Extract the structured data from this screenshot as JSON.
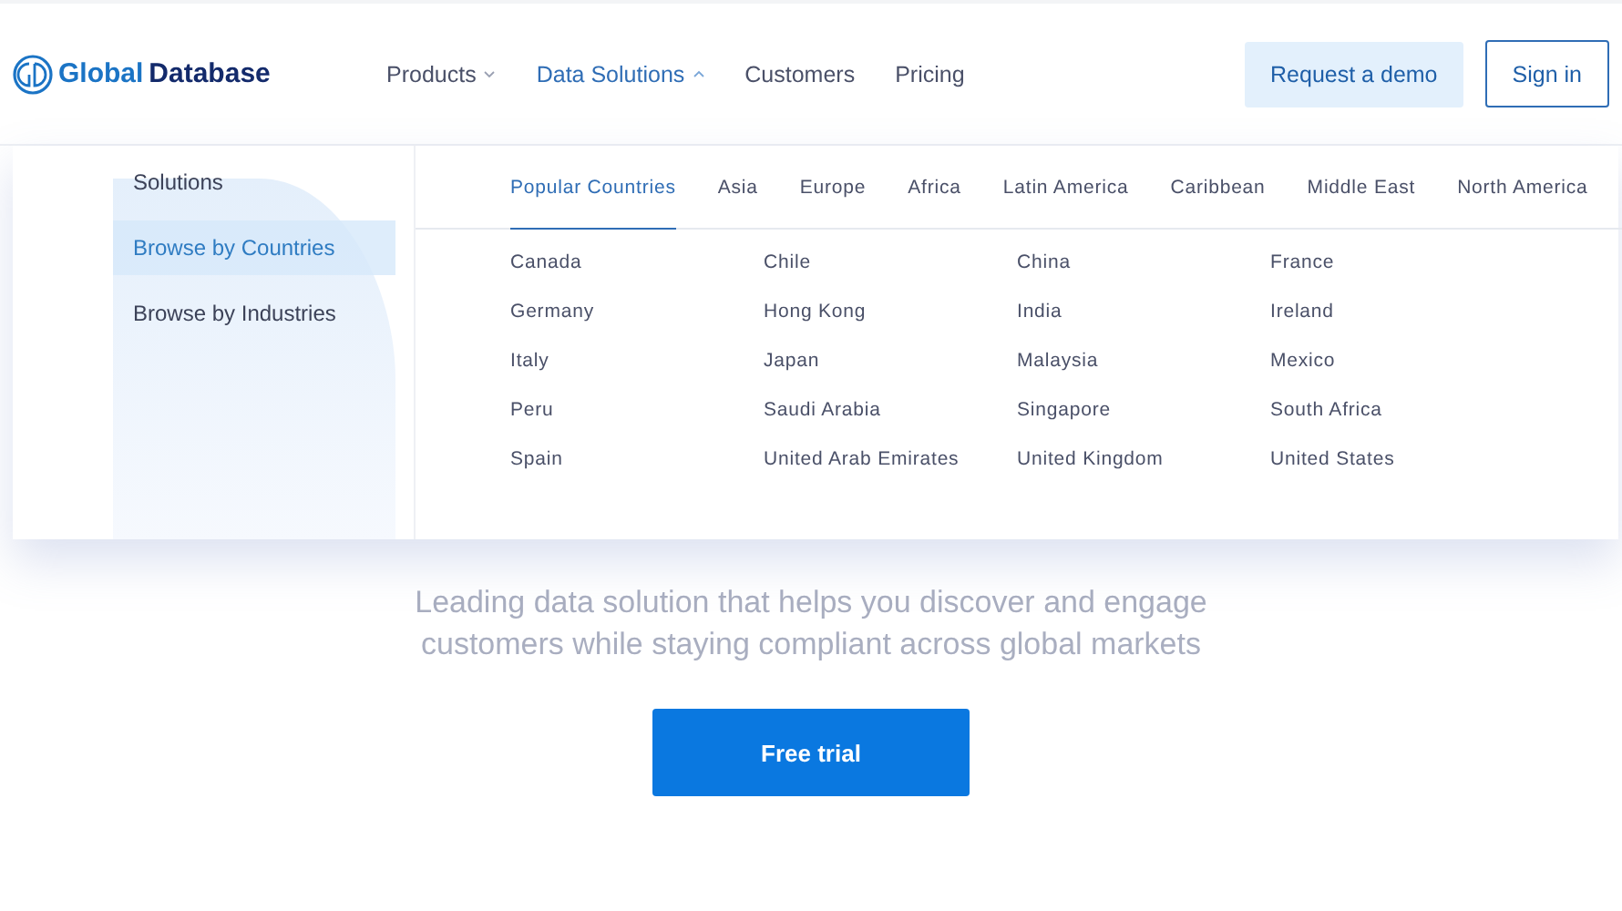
{
  "logo": {
    "word_1": "Global",
    "word_2": "Database"
  },
  "nav": [
    {
      "label": "Products",
      "kind": "dropdown",
      "expanded": false
    },
    {
      "label": "Data Solutions",
      "kind": "dropdown",
      "expanded": true
    },
    {
      "label": "Customers",
      "kind": "link",
      "expanded": false
    },
    {
      "label": "Pricing",
      "kind": "link",
      "expanded": false
    }
  ],
  "header_buttons": [
    {
      "label": "Request a demo",
      "kind": "soft"
    },
    {
      "label": "Sign in",
      "kind": "outline"
    }
  ],
  "dropdown": {
    "sidebar": {
      "heading": "Solutions",
      "items": [
        {
          "label": "Browse by Countries",
          "selected": true
        },
        {
          "label": "Browse by Industries",
          "selected": false
        }
      ]
    },
    "tabs": [
      {
        "label": "Popular Countries",
        "selected": true
      },
      {
        "label": "Asia",
        "selected": false
      },
      {
        "label": "Europe",
        "selected": false
      },
      {
        "label": "Africa",
        "selected": false
      },
      {
        "label": "Latin America",
        "selected": false
      },
      {
        "label": "Caribbean",
        "selected": false
      },
      {
        "label": "Middle East",
        "selected": false
      },
      {
        "label": "North America",
        "selected": false
      }
    ],
    "countries": [
      "Canada",
      "Chile",
      "China",
      "France",
      "Germany",
      "Hong Kong",
      "India",
      "Ireland",
      "Italy",
      "Japan",
      "Malaysia",
      "Mexico",
      "Peru",
      "Saudi Arabia",
      "Singapore",
      "South Africa",
      "Spain",
      "United Arab Emirates",
      "United Kingdom",
      "United States"
    ]
  },
  "hero": {
    "subtitle": "Leading data solution that helps you discover and engage customers while staying compliant across global markets",
    "button": "Free trial"
  }
}
